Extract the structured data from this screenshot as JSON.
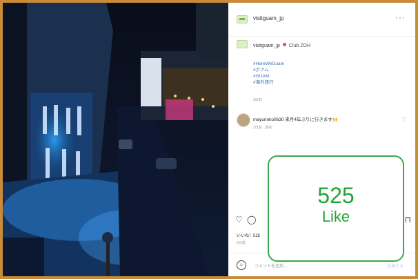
{
  "header": {
    "account": "visitguam_jp",
    "more": "···"
  },
  "post": {
    "account": "visitguam_jp",
    "location": "Club ZOH",
    "tags": [
      "#HereWeGuam",
      "#グアム",
      "#GUAM",
      "#海外旅行"
    ],
    "time": "2日前"
  },
  "comment": {
    "user": "mayurinko0630",
    "text": "来月4年ぶりに行きます🙌",
    "time": "2日前",
    "reply": "返信"
  },
  "likes": "いいね！525",
  "likes_time": "2日前",
  "add_comment": {
    "placeholder": "コメントを追加...",
    "post_label": "投稿する"
  },
  "callout": {
    "count": "525",
    "label": "Like"
  },
  "icons": [
    "heart-icon",
    "comment-icon",
    "bookmark-icon",
    "more-icon",
    "emoji-icon"
  ],
  "colors": {
    "accent_green": "#21a535",
    "tag_blue": "#3b6fb2",
    "frame": "#c98a3a"
  }
}
